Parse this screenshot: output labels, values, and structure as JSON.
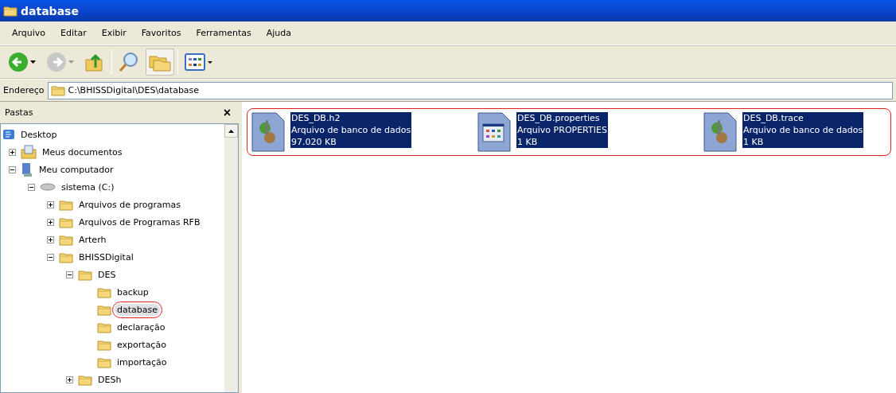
{
  "window": {
    "title": "database"
  },
  "menu": [
    "Arquivo",
    "Editar",
    "Exibir",
    "Favoritos",
    "Ferramentas",
    "Ajuda"
  ],
  "toolbar": [
    {
      "kind": "back"
    },
    {
      "kind": "forward"
    },
    {
      "kind": "up"
    },
    {
      "kind": "search"
    },
    {
      "kind": "folders",
      "selected": true
    },
    {
      "kind": "views"
    }
  ],
  "address": {
    "label": "Endereço",
    "value": "C:\\BHISSDigital\\DES\\database"
  },
  "folders_pane": {
    "title": "Pastas",
    "close": "×",
    "tree": [
      {
        "label": "Desktop",
        "kind": "desktop",
        "children": [
          {
            "label": "Meus documentos",
            "kind": "docs",
            "expanded": false
          },
          {
            "label": "Meu computador",
            "kind": "computer",
            "expanded": true,
            "children": [
              {
                "label": "sistema (C:)",
                "kind": "drive",
                "expanded": true,
                "children": [
                  {
                    "label": "Arquivos de programas",
                    "kind": "folder",
                    "expanded": false
                  },
                  {
                    "label": "Arquivos de Programas RFB",
                    "kind": "folder",
                    "expanded": false
                  },
                  {
                    "label": "Arterh",
                    "kind": "folder",
                    "expanded": false
                  },
                  {
                    "label": "BHISSDigital",
                    "kind": "folder",
                    "expanded": true,
                    "children": [
                      {
                        "label": "DES",
                        "kind": "folder",
                        "expanded": true,
                        "children": [
                          {
                            "label": "backup",
                            "kind": "folder",
                            "selected": false
                          },
                          {
                            "label": "database",
                            "kind": "folder",
                            "selected": true,
                            "circled": true
                          },
                          {
                            "label": "declaração",
                            "kind": "folder",
                            "selected": false
                          },
                          {
                            "label": "exportação",
                            "kind": "folder",
                            "selected": false
                          },
                          {
                            "label": "importação",
                            "kind": "folder",
                            "selected": false
                          }
                        ]
                      },
                      {
                        "label": "DESh",
                        "kind": "folder",
                        "expanded": false
                      }
                    ]
                  }
                ]
              }
            ]
          }
        ]
      }
    ]
  },
  "files": {
    "circled": true,
    "items": [
      {
        "name": "DES_DB.h2",
        "type": "Arquivo de banco de dados",
        "size": "97.020 KB",
        "kind": "db",
        "selected": true
      },
      {
        "name": "DES_DB.properties",
        "type": "Arquivo PROPERTIES",
        "size": "1 KB",
        "kind": "props",
        "selected": true
      },
      {
        "name": "DES_DB.trace",
        "type": "Arquivo de banco de dados",
        "size": "1 KB",
        "kind": "db",
        "selected": true
      }
    ]
  }
}
